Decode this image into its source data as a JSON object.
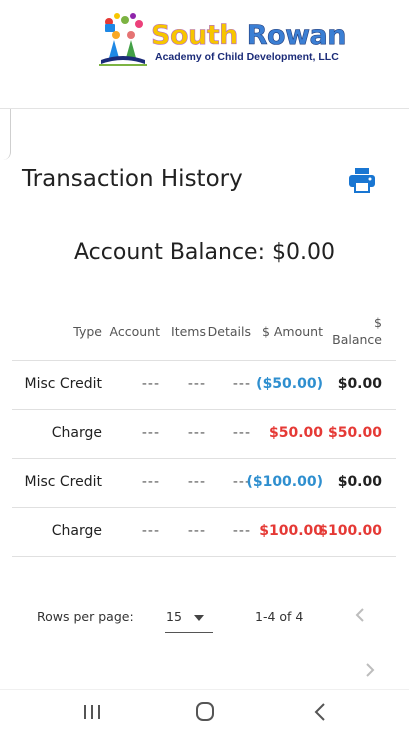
{
  "brand": {
    "word1": "South",
    "word2": "Rowan",
    "subtitle": "Academy of Child Development, LLC"
  },
  "page": {
    "title": "Transaction History",
    "balance_text": "Account Balance: $0.00"
  },
  "table": {
    "headers": {
      "type": "Type",
      "account": "Account",
      "items": "Items",
      "details": "Details",
      "amount": "$ Amount",
      "balance_top": "$",
      "balance_bottom": "Balance"
    },
    "rows": [
      {
        "type": "Misc Credit",
        "account": "---",
        "items": "---",
        "details": "---",
        "amount": "($50.00)",
        "balance": "$0.00"
      },
      {
        "type": "Charge",
        "account": "---",
        "items": "---",
        "details": "---",
        "amount": "$50.00",
        "balance": "$50.00"
      },
      {
        "type": "Misc Credit",
        "account": "---",
        "items": "---",
        "details": "---",
        "amount": "($100.00)",
        "balance": "$0.00"
      },
      {
        "type": "Charge",
        "account": "---",
        "items": "---",
        "details": "---",
        "amount": "$100.00",
        "balance": "$100.00"
      }
    ]
  },
  "pagination": {
    "rows_per_page_label": "Rows per page:",
    "rows_per_page_value": "15",
    "range_text": "1-4 of 4"
  },
  "colors": {
    "credit": "#2f8fcf",
    "charge": "#e53935",
    "accent": "#1976d2"
  }
}
